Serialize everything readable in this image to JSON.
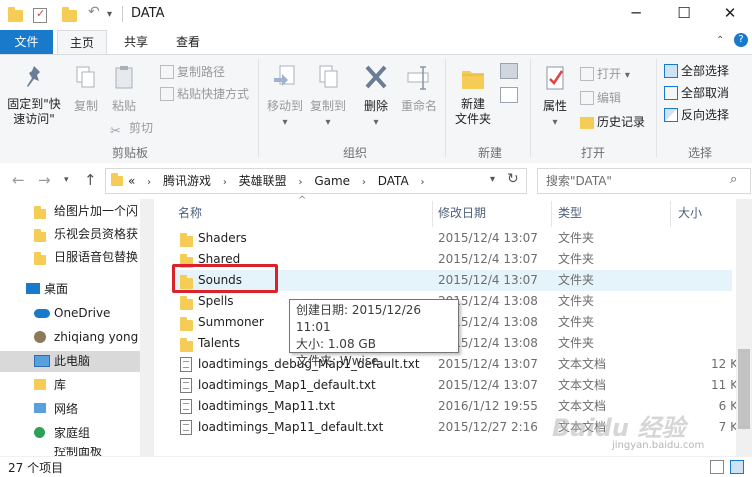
{
  "window": {
    "title": "DATA",
    "minimize": "─",
    "maximize": "☐",
    "close": "✕"
  },
  "ribbon_tabs": [
    "文件",
    "主页",
    "共享",
    "查看"
  ],
  "ribbon": {
    "clipboard": {
      "pin": "固定到\"快速访问\"",
      "copy": "复制",
      "paste": "粘贴",
      "copy_path": "复制路径",
      "paste_shortcut": "粘贴快捷方式",
      "cut": "剪切",
      "group": "剪贴板"
    },
    "organize": {
      "move_to": "移动到",
      "copy_to": "复制到",
      "delete": "删除",
      "rename": "重命名",
      "group": "组织"
    },
    "new": {
      "new_folder": "新建\n文件夹",
      "group": "新建"
    },
    "open": {
      "properties": "属性",
      "open": "打开",
      "edit": "编辑",
      "history": "历史记录",
      "group": "打开"
    },
    "select": {
      "select_all": "全部选择",
      "select_none": "全部取消",
      "invert": "反向选择",
      "group": "选择"
    }
  },
  "address": {
    "prefix": "«",
    "crumbs": [
      "腾讯游戏",
      "英雄联盟",
      "Game",
      "DATA"
    ],
    "search_placeholder": "搜索\"DATA\""
  },
  "nav_pane": [
    {
      "label": "给图片加一个闪"
    },
    {
      "label": "乐视会员资格获"
    },
    {
      "label": "日服语音包替换"
    },
    {
      "label": "桌面"
    },
    {
      "label": "OneDrive"
    },
    {
      "label": "zhiqiang yong"
    },
    {
      "label": "此电脑"
    },
    {
      "label": "库"
    },
    {
      "label": "网络"
    },
    {
      "label": "家庭组"
    },
    {
      "label": "控制面板"
    }
  ],
  "columns": {
    "name": "名称",
    "date": "修改日期",
    "type": "类型",
    "size": "大小"
  },
  "files": [
    {
      "name": "Shaders",
      "date": "2015/12/4 13:07",
      "type": "文件夹",
      "size": ""
    },
    {
      "name": "Shared",
      "date": "2015/12/4 13:07",
      "type": "文件夹",
      "size": ""
    },
    {
      "name": "Sounds",
      "date": "2015/12/4 13:07",
      "type": "文件夹",
      "size": ""
    },
    {
      "name": "Spells",
      "date": "2015/12/4 13:08",
      "type": "文件夹",
      "size": ""
    },
    {
      "name": "Summoner",
      "date": "2015/12/4 13:08",
      "type": "文件夹",
      "size": ""
    },
    {
      "name": "Talents",
      "date": "2015/12/4 13:08",
      "type": "文件夹",
      "size": ""
    },
    {
      "name": "loadtimings_debug_Map1_default.txt",
      "date": "2015/12/4 13:07",
      "type": "文本文档",
      "size": "12 K"
    },
    {
      "name": "loadtimings_Map1_default.txt",
      "date": "2015/12/4 13:07",
      "type": "文本文档",
      "size": "11 K"
    },
    {
      "name": "loadtimings_Map11.txt",
      "date": "2016/1/12 19:55",
      "type": "文本文档",
      "size": "6 K"
    },
    {
      "name": "loadtimings_Map11_default.txt",
      "date": "2015/12/27 2:16",
      "type": "文本文档",
      "size": "7 K"
    }
  ],
  "tooltip": {
    "created": "创建日期: 2015/12/26 11:01",
    "size": "大小: 1.08 GB",
    "folders": "文件夹: Wwise"
  },
  "status": {
    "count": "27 个项目"
  },
  "watermark": {
    "logo": "Baidu 经验",
    "url": "jingyan.baidu.com"
  }
}
